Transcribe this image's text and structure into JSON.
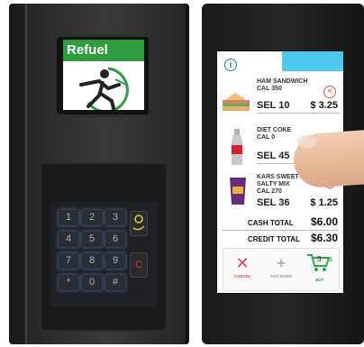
{
  "left_machine": {
    "screen_title": "Refuel",
    "keypad_keys": [
      "1",
      "2",
      "3",
      "4",
      "5",
      "6",
      "7",
      "8",
      "9",
      "*",
      "0",
      "#"
    ],
    "side_key_labels": [
      "",
      "C"
    ]
  },
  "right_machine": {
    "items": [
      {
        "name": "HAM SANDWICH",
        "cal": "CAL  350",
        "sel": "SEL 10",
        "price": "$ 3.25"
      },
      {
        "name": "DIET COKE",
        "cal": "CAL  0",
        "sel": "SEL 45",
        "price": ""
      },
      {
        "name": "KARS SWEET AND SALTY MIX",
        "cal": "CAL  270",
        "sel": "SEL 36",
        "price": "$ 1.25"
      }
    ],
    "cash_total_label": "CASH TOTAL",
    "cash_total_value": "$6.00",
    "credit_total_label": "CREDIT TOTAL",
    "credit_total_value": "$6.30",
    "buttons": [
      {
        "label": "CANCEL",
        "icon": "close-icon",
        "color": "#e04848"
      },
      {
        "label": "ADD MORE",
        "icon": "plus-icon",
        "color": "#9a9a9a"
      },
      {
        "label": "BUY",
        "icon": "cart-icon",
        "color": "#2fa54a"
      }
    ]
  }
}
